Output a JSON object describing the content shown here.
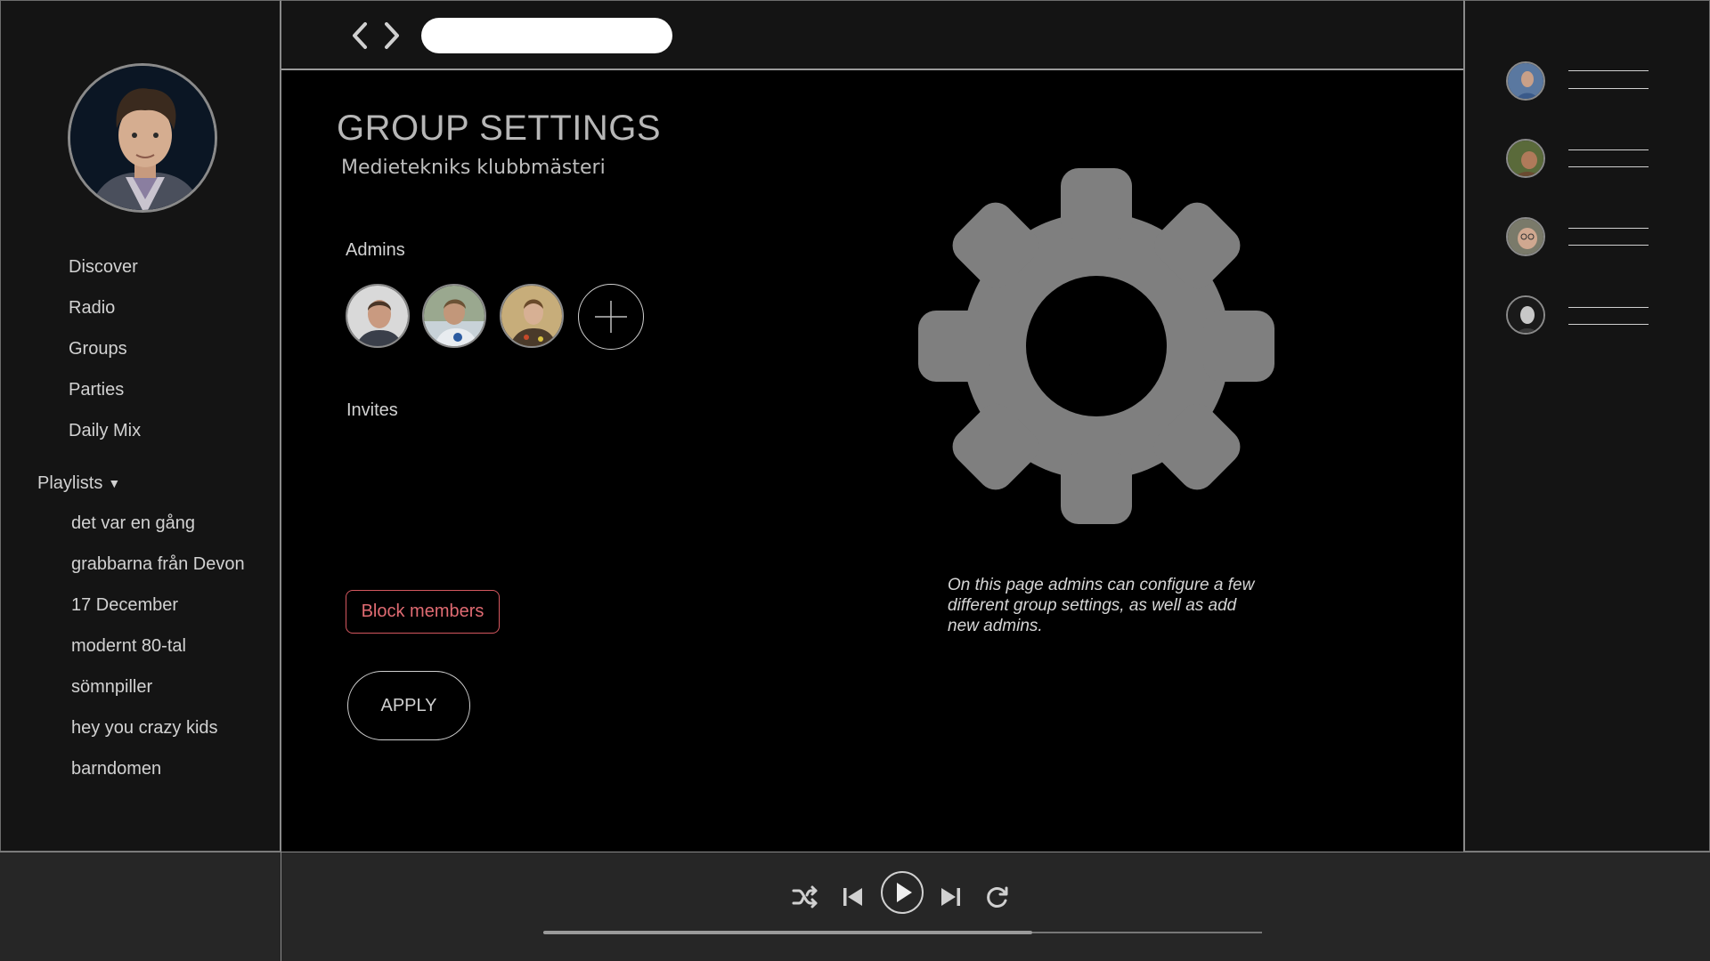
{
  "sidebar": {
    "nav": [
      "Discover",
      "Radio",
      "Groups",
      "Parties",
      "Daily Mix"
    ],
    "playlists_label": "Playlists",
    "playlists": [
      "det var en gång",
      "grabbarna från Devon",
      "17 December",
      "modernt 80-tal",
      "sömnpiller",
      "hey you crazy kids",
      "barndomen"
    ]
  },
  "topbar": {
    "back_icon": "chevron-left-icon",
    "forward_icon": "chevron-right-icon",
    "search_value": ""
  },
  "main": {
    "title": "GROUP SETTINGS",
    "subtitle": "Medietekniks klubbmästeri",
    "admins_label": "Admins",
    "invites_label": "Invites",
    "block_label": "Block members",
    "apply_label": "APPLY",
    "help_text": "On this page admins can configure a few different group settings, as well as add new admins.",
    "gear_icon": "gear-icon"
  },
  "colors": {
    "accent_red": "#e06b72",
    "gear_gray": "#7f7f7f",
    "panel": "#141414",
    "player": "#262626"
  },
  "player": {
    "progress": 0.68,
    "controls": [
      "shuffle-icon",
      "previous-icon",
      "play-icon",
      "next-icon",
      "repeat-icon"
    ]
  }
}
